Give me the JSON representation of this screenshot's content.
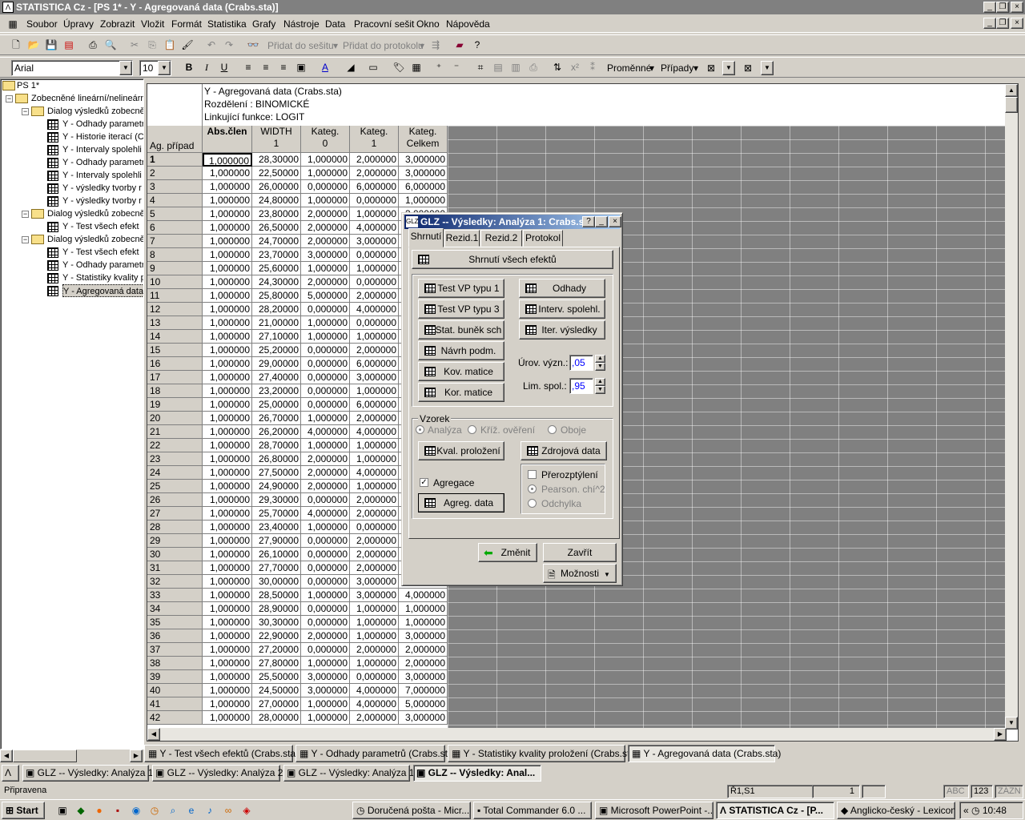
{
  "window": {
    "title": "STATISTICA Cz - [PS 1* - Y - Agregovaná data (Crabs.sta)]",
    "app_icon": "statistica-icon"
  },
  "menu": [
    "Soubor",
    "Úpravy",
    "Zobrazit",
    "Vložit",
    "Formát",
    "Statistika",
    "Grafy",
    "Nástroje",
    "Data",
    "Pracovní sešit",
    "Okno",
    "Nápověda"
  ],
  "toolbar": {
    "add_to_workbook": "Přidat do sešitu",
    "add_to_report": "Přidat do protokolu",
    "variables": "Proměnné",
    "cases": "Případy"
  },
  "format": {
    "font": "Arial",
    "size": "10"
  },
  "tree": {
    "root": "PS 1*",
    "level1": "Zobecněné lineární/nelineárn",
    "dialog_label": "Dialog výsledků zobecně",
    "g1": [
      "Y - Odhady parametr",
      "Y - Historie iterací (Cr",
      "Y - Intervaly spolehli",
      "Y - Odhady parametr",
      "Y - Intervaly spolehli",
      "Y - výsledky tvorby r",
      "Y - výsledky tvorby r"
    ],
    "g2": [
      "Y - Test všech efekt"
    ],
    "g3": [
      "Y - Test všech efekt",
      "Y - Odhady parametr",
      "Y - Statistiky kvality p",
      "Y - Agregovaná data"
    ]
  },
  "sheet": {
    "header_lines": [
      "Y - Agregovaná data (Crabs.sta)",
      "Rozdělení : BINOMICKÉ",
      "Linkující funkce: LOGIT"
    ],
    "corner": "Ag. případ",
    "columns": [
      {
        "top": "Abs.člen",
        "bottom": ""
      },
      {
        "top": "WIDTH",
        "bottom": "1"
      },
      {
        "top": "Kateg.",
        "bottom": "0"
      },
      {
        "top": "Kateg.",
        "bottom": "1"
      },
      {
        "top": "Kateg.",
        "bottom": "Celkem"
      }
    ],
    "rows": [
      [
        "1",
        "1,000000",
        "28,30000",
        "1,000000",
        "2,000000",
        "3,000000"
      ],
      [
        "2",
        "1,000000",
        "22,50000",
        "1,000000",
        "2,000000",
        "3,000000"
      ],
      [
        "3",
        "1,000000",
        "26,00000",
        "0,000000",
        "6,000000",
        "6,000000"
      ],
      [
        "4",
        "1,000000",
        "24,80000",
        "1,000000",
        "0,000000",
        "1,000000"
      ],
      [
        "5",
        "1,000000",
        "23,80000",
        "2,000000",
        "1,000000",
        "3,000000"
      ],
      [
        "6",
        "1,000000",
        "26,50000",
        "2,000000",
        "4,000000",
        "6,000000"
      ],
      [
        "7",
        "1,000000",
        "24,70000",
        "2,000000",
        "3,000000",
        "5,000000"
      ],
      [
        "8",
        "1,000000",
        "23,70000",
        "3,000000",
        "0,000000",
        "3,000000"
      ],
      [
        "9",
        "1,000000",
        "25,60000",
        "1,000000",
        "1,000000",
        "2,000000"
      ],
      [
        "10",
        "1,000000",
        "24,30000",
        "2,000000",
        "0,000000",
        "2,000000"
      ],
      [
        "11",
        "1,000000",
        "25,80000",
        "5,000000",
        "2,000000",
        "7,000000"
      ],
      [
        "12",
        "1,000000",
        "28,20000",
        "0,000000",
        "4,000000",
        "4,000000"
      ],
      [
        "13",
        "1,000000",
        "21,00000",
        "1,000000",
        "0,000000",
        "1,000000"
      ],
      [
        "14",
        "1,000000",
        "27,10000",
        "1,000000",
        "1,000000",
        "2,000000"
      ],
      [
        "15",
        "1,000000",
        "25,20000",
        "0,000000",
        "2,000000",
        "2,000000"
      ],
      [
        "16",
        "1,000000",
        "29,00000",
        "0,000000",
        "6,000000",
        "6,000000"
      ],
      [
        "17",
        "1,000000",
        "27,40000",
        "0,000000",
        "3,000000",
        "3,000000"
      ],
      [
        "18",
        "1,000000",
        "23,20000",
        "0,000000",
        "1,000000",
        "1,000000"
      ],
      [
        "19",
        "1,000000",
        "25,00000",
        "0,000000",
        "6,000000",
        "6,000000"
      ],
      [
        "20",
        "1,000000",
        "26,70000",
        "1,000000",
        "2,000000",
        "3,000000"
      ],
      [
        "21",
        "1,000000",
        "26,20000",
        "4,000000",
        "4,000000",
        "8,000000"
      ],
      [
        "22",
        "1,000000",
        "28,70000",
        "1,000000",
        "1,000000",
        "2,000000"
      ],
      [
        "23",
        "1,000000",
        "26,80000",
        "2,000000",
        "1,000000",
        "3,000000"
      ],
      [
        "24",
        "1,000000",
        "27,50000",
        "2,000000",
        "4,000000",
        "6,000000"
      ],
      [
        "25",
        "1,000000",
        "24,90000",
        "2,000000",
        "1,000000",
        "3,000000"
      ],
      [
        "26",
        "1,000000",
        "29,30000",
        "0,000000",
        "2,000000",
        "2,000000"
      ],
      [
        "27",
        "1,000000",
        "25,70000",
        "4,000000",
        "2,000000",
        "6,000000"
      ],
      [
        "28",
        "1,000000",
        "23,40000",
        "1,000000",
        "0,000000",
        "1,000000"
      ],
      [
        "29",
        "1,000000",
        "27,90000",
        "0,000000",
        "2,000000",
        "2,000000"
      ],
      [
        "30",
        "1,000000",
        "26,10000",
        "0,000000",
        "2,000000",
        "2,000000"
      ],
      [
        "31",
        "1,000000",
        "27,70000",
        "0,000000",
        "2,000000",
        "2,000000"
      ],
      [
        "32",
        "1,000000",
        "30,00000",
        "0,000000",
        "3,000000",
        "3,000000"
      ],
      [
        "33",
        "1,000000",
        "28,50000",
        "1,000000",
        "3,000000",
        "4,000000"
      ],
      [
        "34",
        "1,000000",
        "28,90000",
        "0,000000",
        "1,000000",
        "1,000000"
      ],
      [
        "35",
        "1,000000",
        "30,30000",
        "0,000000",
        "1,000000",
        "1,000000"
      ],
      [
        "36",
        "1,000000",
        "22,90000",
        "2,000000",
        "1,000000",
        "3,000000"
      ],
      [
        "37",
        "1,000000",
        "27,20000",
        "0,000000",
        "2,000000",
        "2,000000"
      ],
      [
        "38",
        "1,000000",
        "27,80000",
        "1,000000",
        "1,000000",
        "2,000000"
      ],
      [
        "39",
        "1,000000",
        "25,50000",
        "3,000000",
        "0,000000",
        "3,000000"
      ],
      [
        "40",
        "1,000000",
        "24,50000",
        "3,000000",
        "4,000000",
        "7,000000"
      ],
      [
        "41",
        "1,000000",
        "27,00000",
        "1,000000",
        "4,000000",
        "5,000000"
      ],
      [
        "42",
        "1,000000",
        "28,00000",
        "1,000000",
        "2,000000",
        "3,000000"
      ]
    ]
  },
  "sheet_tabs": [
    "Y - Test všech efektů (Crabs.sta)",
    "Y - Odhady parametrů (Crabs.sta)",
    "Y - Statistiky kvality proložení (Crabs.sta)",
    "Y - Agregovaná data (Crabs.sta)"
  ],
  "minimized": [
    "GLZ -- Výsledky: Analýza 1...",
    "GLZ -- Výsledky: Analýza 2...",
    "GLZ -- Výsledky: Analýza 1...",
    "GLZ -- Výsledky: Anal..."
  ],
  "status": {
    "text": "Připravena",
    "cell": "Ř1,S1",
    "value": "1",
    "abc": "ABC",
    "num": "123",
    "zazn": "ZÁZN"
  },
  "taskbar": {
    "start": "Start",
    "items": [
      "Doručená pošta - Micr...",
      "Total Commander 6.0 ...",
      "Microsoft PowerPoint -...",
      "STATISTICA Cz - [P...",
      "Anglicko-český - Lexicon"
    ],
    "tray_arrow": "«",
    "clock": "10:48"
  },
  "dialog": {
    "title": "GLZ -- Výsledky: Analýza 1: Crabs.sta",
    "tabs": [
      "Shrnutí",
      "Rezid.1",
      "Rezid.2",
      "Protokol"
    ],
    "summary_button": "Shrnutí všech efektů",
    "left_buttons": [
      "Test VP typu 1",
      "Test VP typu 3",
      "Stat. buněk sch",
      "Návrh podm.",
      "Kov. matice",
      "Kor. matice"
    ],
    "right_buttons": [
      "Odhady",
      "Interv. spolehl.",
      "Iter. výsledky"
    ],
    "alpha_label": "Úrov. význ.:",
    "alpha": ",05",
    "conf_label": "Lim. spol.:",
    "conf": ",95",
    "sample_label": "Vzorek",
    "sample_options": [
      "Analýza",
      "Kříž. ověření",
      "Oboje"
    ],
    "fit_button": "Kval. proložení",
    "source_button": "Zdrojová data",
    "aggregation": "Agregace",
    "agg_button": "Agreg. data",
    "overdisp": "Přerozptýlení",
    "overdisp_opts": [
      "Pearson. chí^2",
      "Odchylka"
    ],
    "modify": "Změnit",
    "close": "Zavřít",
    "options": "Možnosti"
  }
}
